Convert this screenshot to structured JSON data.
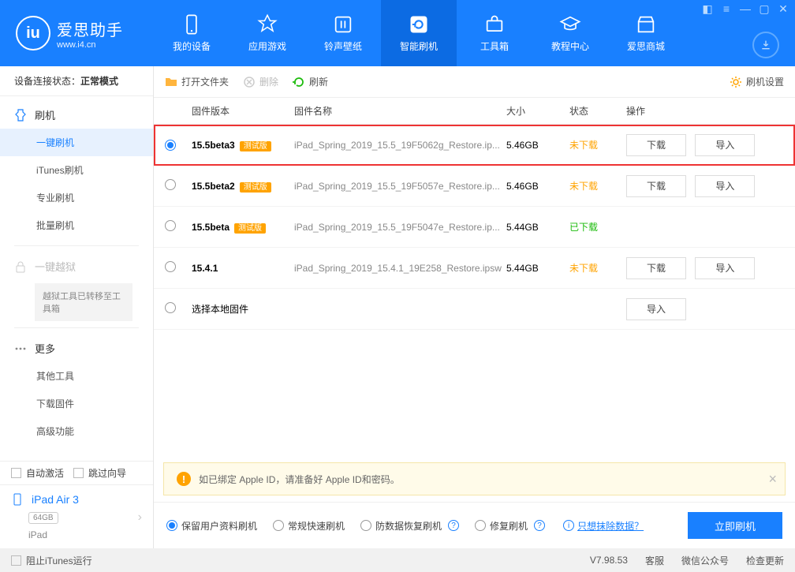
{
  "brand": {
    "title": "爱思助手",
    "url": "www.i4.cn"
  },
  "nav": {
    "items": [
      {
        "label": "我的设备"
      },
      {
        "label": "应用游戏"
      },
      {
        "label": "铃声壁纸"
      },
      {
        "label": "智能刷机"
      },
      {
        "label": "工具箱"
      },
      {
        "label": "教程中心"
      },
      {
        "label": "爱思商城"
      }
    ]
  },
  "device_status": {
    "prefix": "设备连接状态：",
    "value": "正常模式"
  },
  "sidebar": {
    "flash": "刷机",
    "subs": [
      "一键刷机",
      "iTunes刷机",
      "专业刷机",
      "批量刷机"
    ],
    "jailbreak": "一键越狱",
    "jailbreak_note": "越狱工具已转移至工具箱",
    "more": "更多",
    "more_subs": [
      "其他工具",
      "下载固件",
      "高级功能"
    ],
    "auto_activate": "自动激活",
    "skip_guide": "跳过向导",
    "device_name": "iPad Air 3",
    "storage": "64GB",
    "device_type": "iPad"
  },
  "toolbar": {
    "open": "打开文件夹",
    "delete": "删除",
    "refresh": "刷新",
    "settings": "刷机设置"
  },
  "table": {
    "headers": {
      "version": "固件版本",
      "name": "固件名称",
      "size": "大小",
      "status": "状态",
      "actions": "操作"
    },
    "beta_tag": "测试版",
    "download_btn": "下载",
    "import_btn": "导入",
    "local_firmware": "选择本地固件",
    "rows": [
      {
        "version": "15.5beta3",
        "beta": true,
        "name": "iPad_Spring_2019_15.5_19F5062g_Restore.ip...",
        "size": "5.46GB",
        "status": "未下载",
        "status_class": "not",
        "selected": true,
        "download": true,
        "import": true
      },
      {
        "version": "15.5beta2",
        "beta": true,
        "name": "iPad_Spring_2019_15.5_19F5057e_Restore.ip...",
        "size": "5.46GB",
        "status": "未下载",
        "status_class": "not",
        "selected": false,
        "download": true,
        "import": true
      },
      {
        "version": "15.5beta",
        "beta": true,
        "name": "iPad_Spring_2019_15.5_19F5047e_Restore.ip...",
        "size": "5.44GB",
        "status": "已下载",
        "status_class": "done",
        "selected": false,
        "download": false,
        "import": false
      },
      {
        "version": "15.4.1",
        "beta": false,
        "name": "iPad_Spring_2019_15.4.1_19E258_Restore.ipsw",
        "size": "5.44GB",
        "status": "未下载",
        "status_class": "not",
        "selected": false,
        "download": true,
        "import": true
      }
    ]
  },
  "alert": "如已绑定 Apple ID，请准备好 Apple ID和密码。",
  "flash_modes": {
    "options": [
      "保留用户资料刷机",
      "常规快速刷机",
      "防数据恢复刷机",
      "修复刷机"
    ],
    "erase_link": "只想抹除数据？",
    "flash_btn": "立即刷机"
  },
  "footer": {
    "block_itunes": "阻止iTunes运行",
    "version": "V7.98.53",
    "support": "客服",
    "wechat": "微信公众号",
    "update": "检查更新"
  }
}
